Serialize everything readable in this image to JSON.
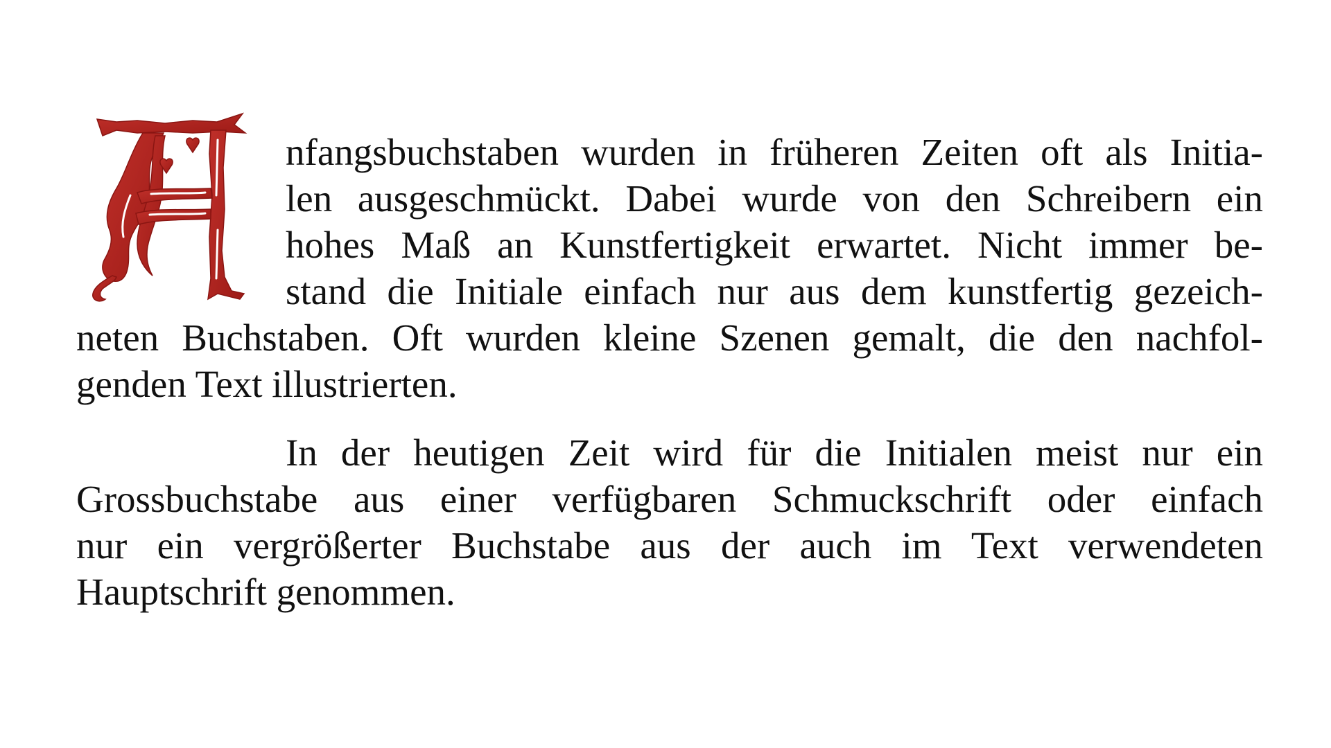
{
  "paragraphs": [
    {
      "initial_letter": "A",
      "lines": [
        "nfangsbuchstaben wurden in früheren Zeiten oft als Initia-",
        "len ausgeschmückt. Dabei wurde von den Schreibern ein",
        "hohes Maß an Kunstfertigkeit erwartet. Nicht immer be-",
        "stand die Initiale einfach nur aus dem kunstfertig gezeich-",
        "neten Buchstaben. Oft wurden kleine Szenen gemalt, die den nachfol-",
        "genden Text illustrierten."
      ]
    },
    {
      "lines": [
        "In der heutigen Zeit wird für die Initialen meist nur ein",
        "Grossbuchstabe aus einer verfügbaren Schmuckschrift oder einfach",
        "nur ein vergrößerter Buchstabe aus der auch im Text verwendeten",
        "Hauptschrift genommen."
      ]
    }
  ],
  "colors": {
    "initial": "#b22222",
    "text": "#111111",
    "background": "#ffffff"
  }
}
